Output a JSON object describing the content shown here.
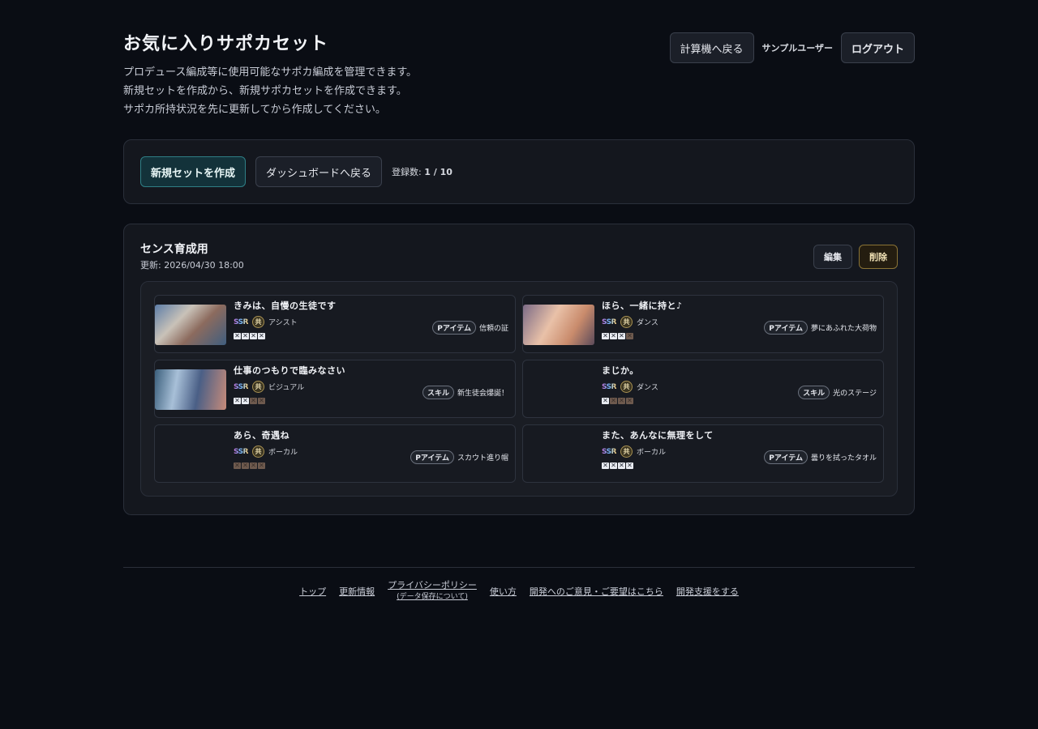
{
  "header": {
    "title": "お気に入りサポカセット",
    "description": [
      "プロデュース編成等に使用可能なサポカ編成を管理できます。",
      "新規セットを作成から、新規サポカセットを作成できます。",
      "サポカ所持状況を先に更新してから作成してください。"
    ],
    "back_to_calc": "計算機へ戻る",
    "user_name": "サンプルユーザー",
    "logout": "ログアウト"
  },
  "toolbar": {
    "create_label": "新規セットを作成",
    "dashboard_label": "ダッシュボードへ戻る",
    "count_label": "登録数:",
    "count_value": "1 / 10"
  },
  "set": {
    "name": "センス育成用",
    "updated": "更新: 2026/04/30 18:00",
    "edit_label": "編集",
    "delete_label": "削除",
    "cards": [
      {
        "title": "きみは、自慢の生徒です",
        "rarity": "SSR",
        "common": "共",
        "type": "アシスト",
        "stars": [
          true,
          true,
          true,
          true
        ],
        "effect_kind": "Pアイテム",
        "effect": "信頼の証",
        "image": "has-img"
      },
      {
        "title": "ほら、一緒に持と♪",
        "rarity": "SSR",
        "common": "共",
        "type": "ダンス",
        "stars": [
          true,
          true,
          true,
          false
        ],
        "effect_kind": "Pアイテム",
        "effect": "夢にあふれた大荷物",
        "image": "img2"
      },
      {
        "title": "仕事のつもりで臨みなさい",
        "rarity": "SSR",
        "common": "共",
        "type": "ビジュアル",
        "stars": [
          true,
          true,
          false,
          false
        ],
        "effect_kind": "スキル",
        "effect": "新生徒会爆誕！",
        "image": "img3"
      },
      {
        "title": "まじか。",
        "rarity": "SSR",
        "common": "共",
        "type": "ダンス",
        "stars": [
          true,
          false,
          false,
          false
        ],
        "effect_kind": "スキル",
        "effect": "光のステージ",
        "image": ""
      },
      {
        "title": "あら、奇遇ね",
        "rarity": "SSR",
        "common": "共",
        "type": "ボーカル",
        "stars": [
          false,
          false,
          false,
          false
        ],
        "effect_kind": "Pアイテム",
        "effect": "スカウト進り帽",
        "image": ""
      },
      {
        "title": "また、あんなに無理をして",
        "rarity": "SSR",
        "common": "共",
        "type": "ボーカル",
        "stars": [
          true,
          true,
          true,
          true
        ],
        "effect_kind": "Pアイテム",
        "effect": "曇りを拭ったタオル",
        "image": ""
      }
    ]
  },
  "footer": {
    "top": "トップ",
    "updates": "更新情報",
    "privacy": "プライバシーポリシー",
    "privacy_sub": "(データ保存について)",
    "usage": "使い方",
    "feedback": "開発へのご意見・ご要望はこちら",
    "support": "開発支援をする"
  }
}
